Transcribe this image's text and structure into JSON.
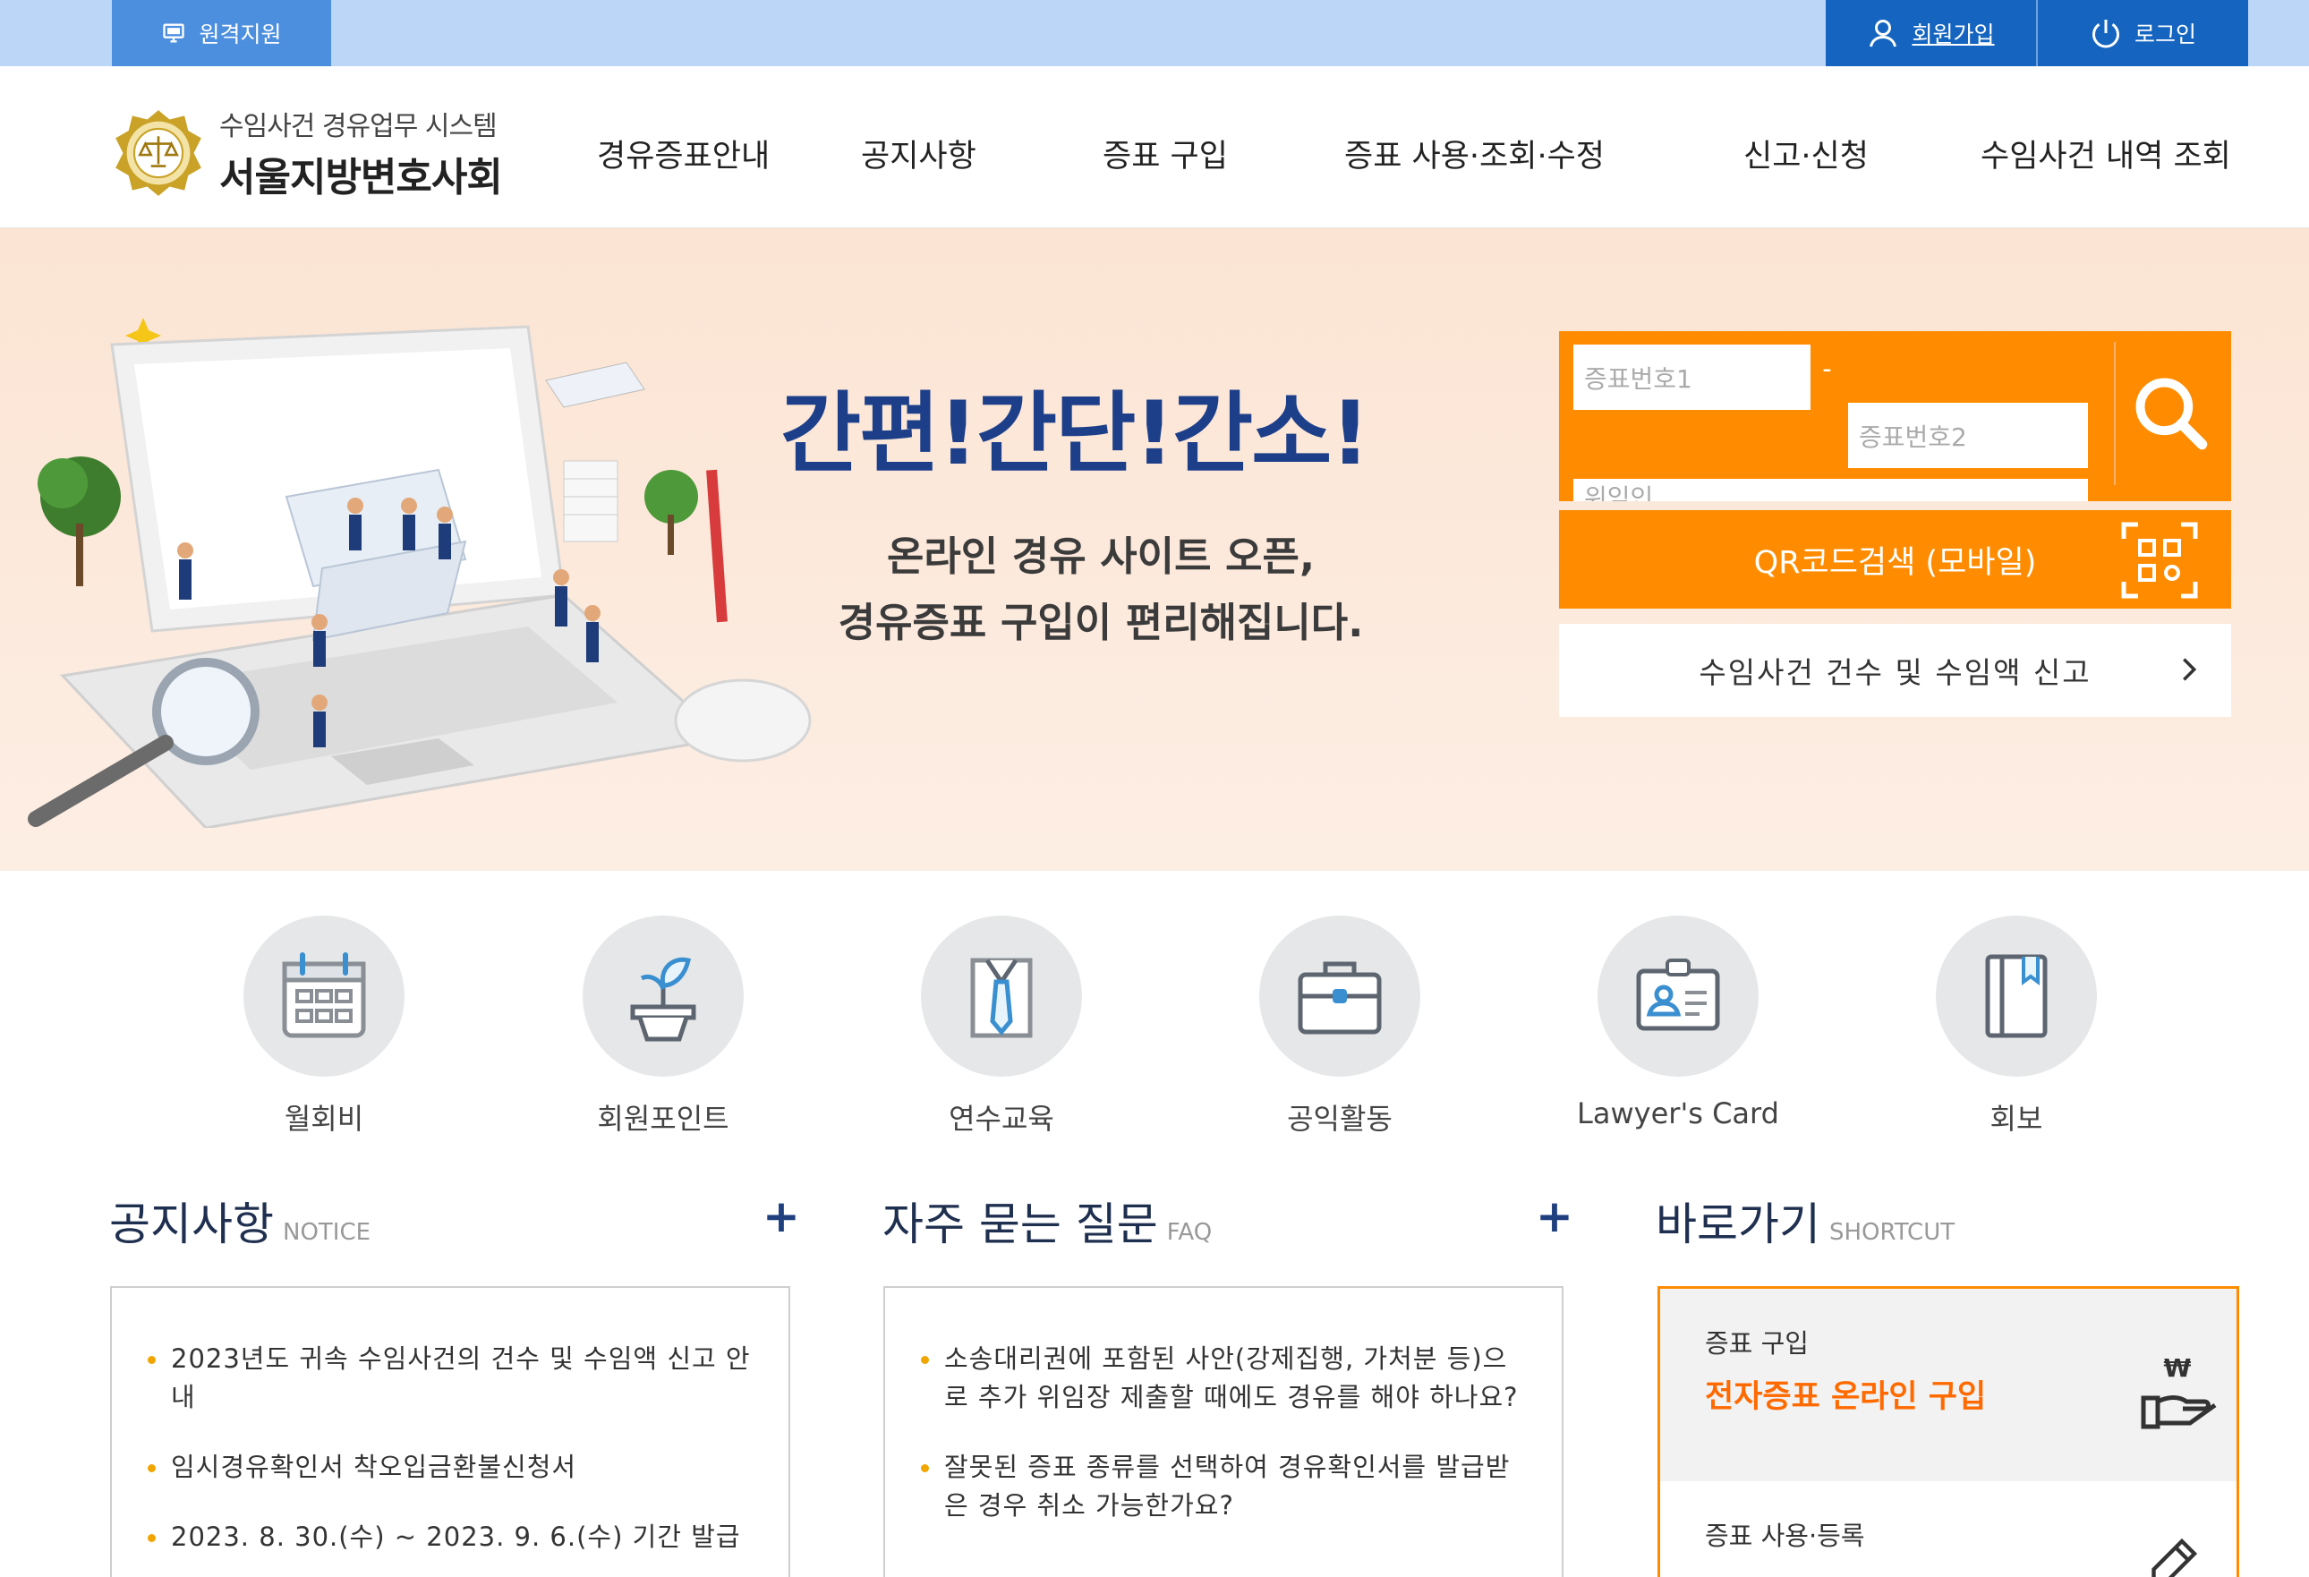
{
  "topbar": {
    "remote_label": "원격지원",
    "join_label": "회원가입",
    "login_label": "로그인"
  },
  "logo": {
    "subtitle": "수임사건 경유업무 시스템",
    "title": "서울지방변호사회"
  },
  "nav": {
    "items": [
      "경유증표안내",
      "공지사항",
      "증표 구입",
      "증표 사용·조회·수정",
      "신고·신청",
      "수임사건 내역 조회"
    ]
  },
  "hero": {
    "title": "간편!간단!간소!",
    "desc_line1": "온라인 경유 사이트 오픈,",
    "desc_line2": "경유증표 구입이 편리해집니다."
  },
  "search": {
    "placeholder1": "증표번호1",
    "placeholder2": "증표번호2",
    "placeholder3": "위임인",
    "dash": "-",
    "qr_label": "QR코드검색 (모바일)",
    "report_label": "수임사건 건수 및 수임액 신고"
  },
  "quick": {
    "items": [
      "월회비",
      "회원포인트",
      "연수교육",
      "공익활동",
      "Lawyer's Card",
      "회보"
    ]
  },
  "notice": {
    "title": "공지사항",
    "title_en": "NOTICE",
    "plus": "+",
    "items": [
      "2023년도 귀속 수임사건의 건수 및 수임액 신고 안내",
      "임시경유확인서 착오입금환불신청서",
      "2023. 8. 30.(수) ~ 2023. 9. 6.(수) 기간 발급"
    ]
  },
  "faq": {
    "title": "자주 묻는 질문",
    "title_en": "FAQ",
    "plus": "+",
    "items": [
      "소송대리권에 포함된 사안(강제집행, 가처분 등)으로 추가 위임장 제출할 때에도 경유를 해야 하나요?",
      "잘못된 증표 종류를 선택하여 경유확인서를 발급받은 경우 취소 가능한가요?"
    ]
  },
  "shortcut": {
    "title": "바로가기",
    "title_en": "SHORTCUT",
    "item1_small": "증표 구입",
    "item1_big": "전자증표 온라인 구입",
    "item2_small": "증표 사용·등록"
  },
  "colors": {
    "accent_orange": "#ff8c00",
    "topbar_blue": "#1565c0",
    "title_navy": "#1d3f8a"
  }
}
